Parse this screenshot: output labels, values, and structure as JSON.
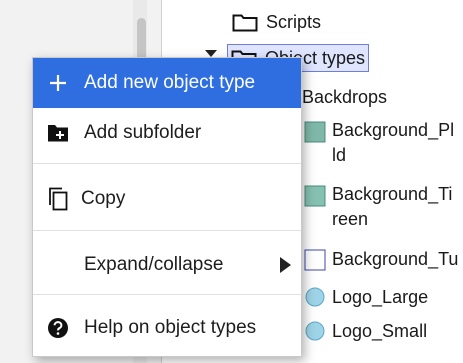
{
  "tree": {
    "items": [
      {
        "label": "Scripts",
        "icon": "folder-icon"
      },
      {
        "label": "Object types",
        "icon": "folder-icon",
        "selected": true
      },
      {
        "label": "Backdrops",
        "icon": "folder-icon"
      },
      {
        "label": "Background_Pl\nld",
        "icon": "sprite-icon"
      },
      {
        "label": "Background_Ti\nreen",
        "icon": "sprite-icon"
      },
      {
        "label": "Background_Tu",
        "icon": "sprite-icon"
      },
      {
        "label": "Logo_Large",
        "icon": "sprite-icon"
      },
      {
        "label": "Logo_Small",
        "icon": "sprite-icon"
      }
    ]
  },
  "context_menu": {
    "items": [
      {
        "label": "Add new object type",
        "icon": "plus-icon",
        "highlighted": true
      },
      {
        "label": "Add subfolder",
        "icon": "add-folder-icon"
      },
      {
        "label": "Copy",
        "icon": "copy-icon"
      },
      {
        "label": "Expand/collapse",
        "icon": "",
        "has_submenu": true
      },
      {
        "label": "Help on object types",
        "icon": "help-icon"
      }
    ]
  },
  "colors": {
    "highlight": "#2f6ee0",
    "selection_bg": "#dfe4ff",
    "selection_border": "#6f7fd8"
  }
}
